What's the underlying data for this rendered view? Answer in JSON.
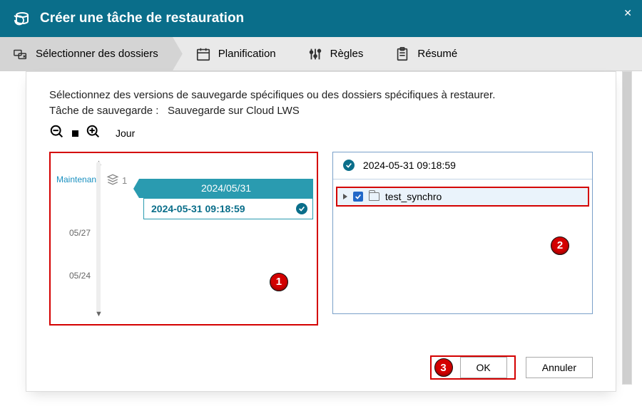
{
  "window": {
    "title": "Créer une tâche de restauration"
  },
  "steps": {
    "select": "Sélectionner des dossiers",
    "schedule": "Planification",
    "rules": "Règles",
    "summary": "Résumé"
  },
  "main": {
    "intro": "Sélectionnez des versions de sauvegarde spécifiques ou des dossiers spécifiques à restaurer.",
    "task_label": "Tâche de sauvegarde :",
    "task_name": "Sauvegarde sur Cloud LWS",
    "time_unit": "Jour"
  },
  "timeline": {
    "now": "Maintenant",
    "count": "1",
    "ticks": [
      "05/27",
      "05/24"
    ],
    "group_date": "2024/05/31",
    "snapshot": "2024-05-31 09:18:59"
  },
  "files": {
    "header_snapshot": "2024-05-31 09:18:59",
    "folder": "test_synchro"
  },
  "annotations": {
    "one": "1",
    "two": "2",
    "three": "3"
  },
  "buttons": {
    "ok": "OK",
    "cancel": "Annuler"
  }
}
